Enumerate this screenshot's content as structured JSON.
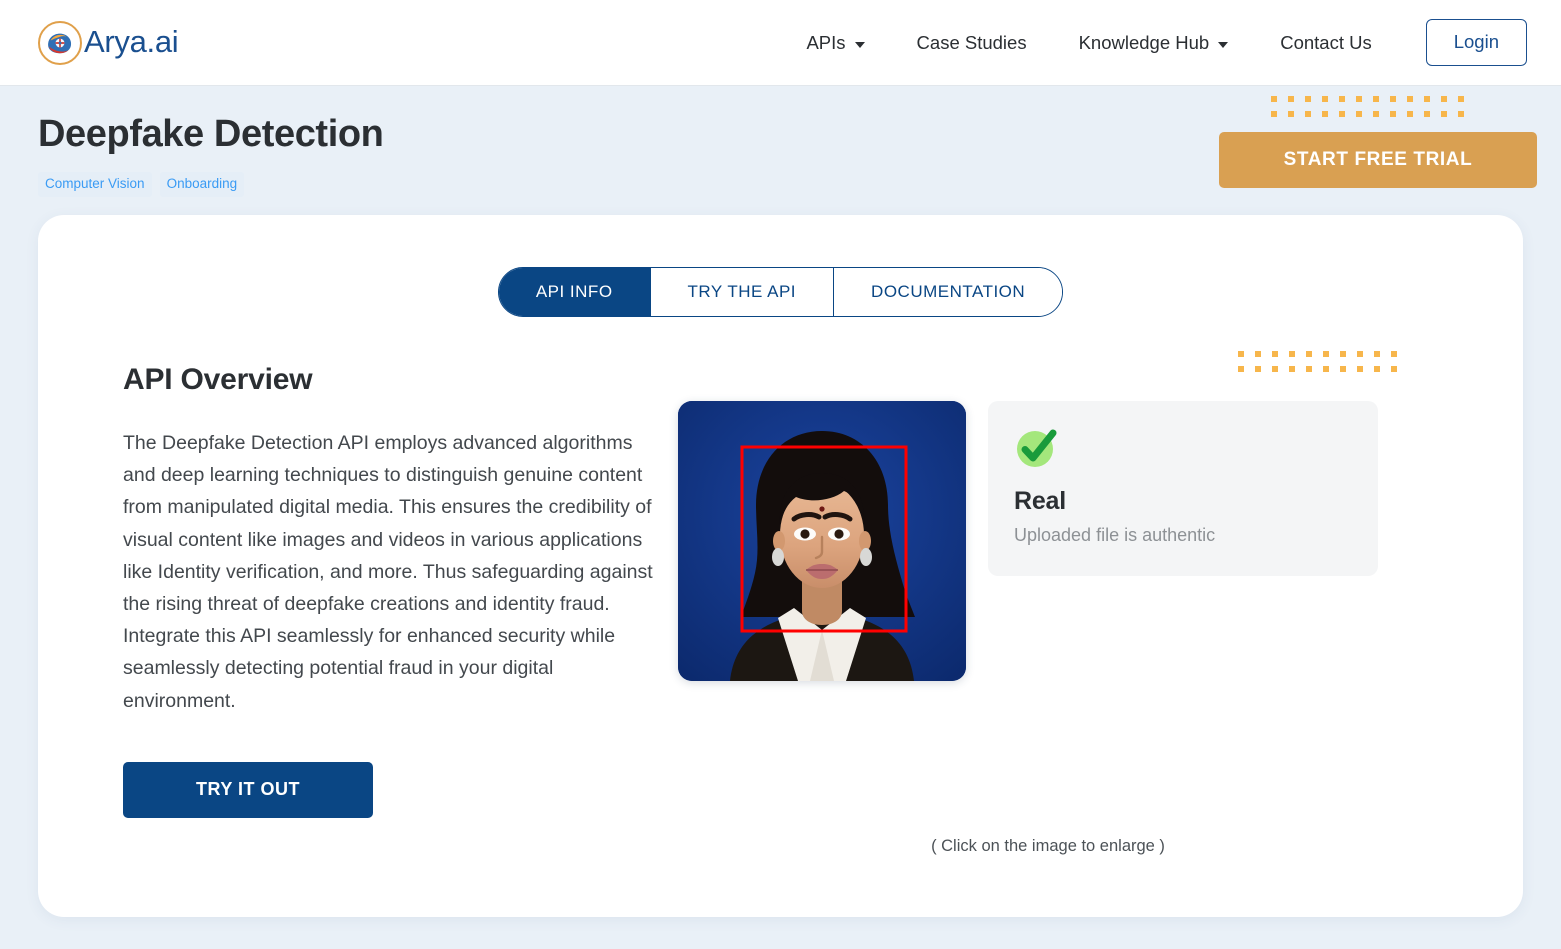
{
  "header": {
    "brand_name": "Arya.ai",
    "brand_icon": "brain-circle-logo",
    "nav_items": [
      {
        "label": "APIs",
        "has_dropdown": true
      },
      {
        "label": "Case Studies",
        "has_dropdown": false
      },
      {
        "label": "Knowledge Hub",
        "has_dropdown": true
      },
      {
        "label": "Contact Us",
        "has_dropdown": false
      }
    ],
    "login_label": "Login"
  },
  "page": {
    "title": "Deepfake Detection",
    "tags": [
      "Computer Vision",
      "Onboarding"
    ],
    "trial_button_label": "START FREE TRIAL",
    "dots_top_rows": 2,
    "dots_top_cols": 12
  },
  "tabs": [
    {
      "label": "API INFO",
      "active": true
    },
    {
      "label": "TRY THE API",
      "active": false
    },
    {
      "label": "DOCUMENTATION",
      "active": false
    }
  ],
  "overview": {
    "heading": "API Overview",
    "body": "The Deepfake Detection API employs advanced algorithms and deep learning techniques to distinguish genuine content from manipulated digital media. This ensures the credibility of visual content like images and videos in various applications like Identity verification, and more. Thus safeguarding against the rising threat of deepfake creations and identity fraud. Integrate this API seamlessly for enhanced security while seamlessly detecting potential fraud in your digital environment.",
    "cta_label": "TRY IT OUT"
  },
  "demo": {
    "image_alt": "passport-photo-with-face-detection-box",
    "face_box_color": "#ff0000",
    "result": {
      "status_icon": "green-check-circle",
      "verdict": "Real",
      "description": "Uploaded file is authentic"
    },
    "enlarge_note": "( Click on the image to enlarge )",
    "dots_mid_rows": 2,
    "dots_mid_cols": 10
  },
  "colors": {
    "page_background": "#e9f0f7",
    "primary_blue": "#0a4684",
    "accent_orange": "#d9a052",
    "dot_orange": "#f7b64b",
    "tag_blue": "#3a9bf4",
    "success_green": "#1a9e3f",
    "card_white": "#ffffff"
  }
}
